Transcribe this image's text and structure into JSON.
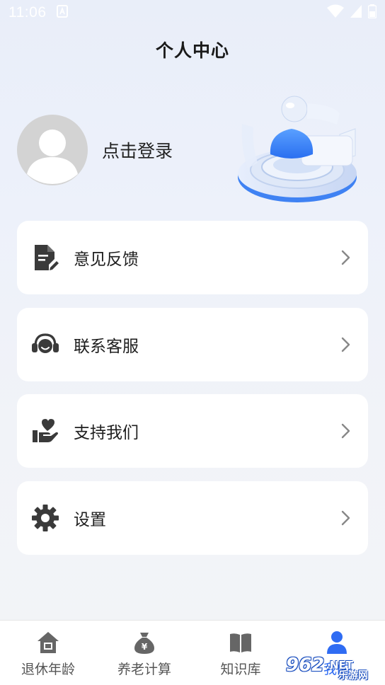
{
  "status_bar": {
    "time": "11:06",
    "notification_icon": "a-icon",
    "wifi_icon": "wifi-icon",
    "signal_icon": "signal-icon",
    "battery_icon": "battery-icon"
  },
  "header": {
    "title": "个人中心"
  },
  "profile": {
    "login_label": "点击登录",
    "avatar_icon": "avatar-placeholder-icon"
  },
  "menu": [
    {
      "label": "意见反馈",
      "icon": "feedback-document-icon"
    },
    {
      "label": "联系客服",
      "icon": "headset-icon"
    },
    {
      "label": "支持我们",
      "icon": "heart-hand-icon"
    },
    {
      "label": "设置",
      "icon": "gear-icon"
    }
  ],
  "tabbar": {
    "tabs": [
      {
        "label": "退休年龄",
        "icon": "house-icon",
        "active": false
      },
      {
        "label": "养老计算",
        "icon": "money-bag-icon",
        "active": false
      },
      {
        "label": "知识库",
        "icon": "book-icon",
        "active": false
      },
      {
        "label": "我的",
        "icon": "person-icon",
        "active": true
      }
    ]
  },
  "colors": {
    "accent": "#2f6cf3",
    "icon_gray": "#3a3a3a",
    "chevron_gray": "#888888",
    "avatar_gray": "#d3d3d3"
  },
  "watermark": {
    "main": "962",
    "suffix": ".NET",
    "caption": "乐游网"
  }
}
